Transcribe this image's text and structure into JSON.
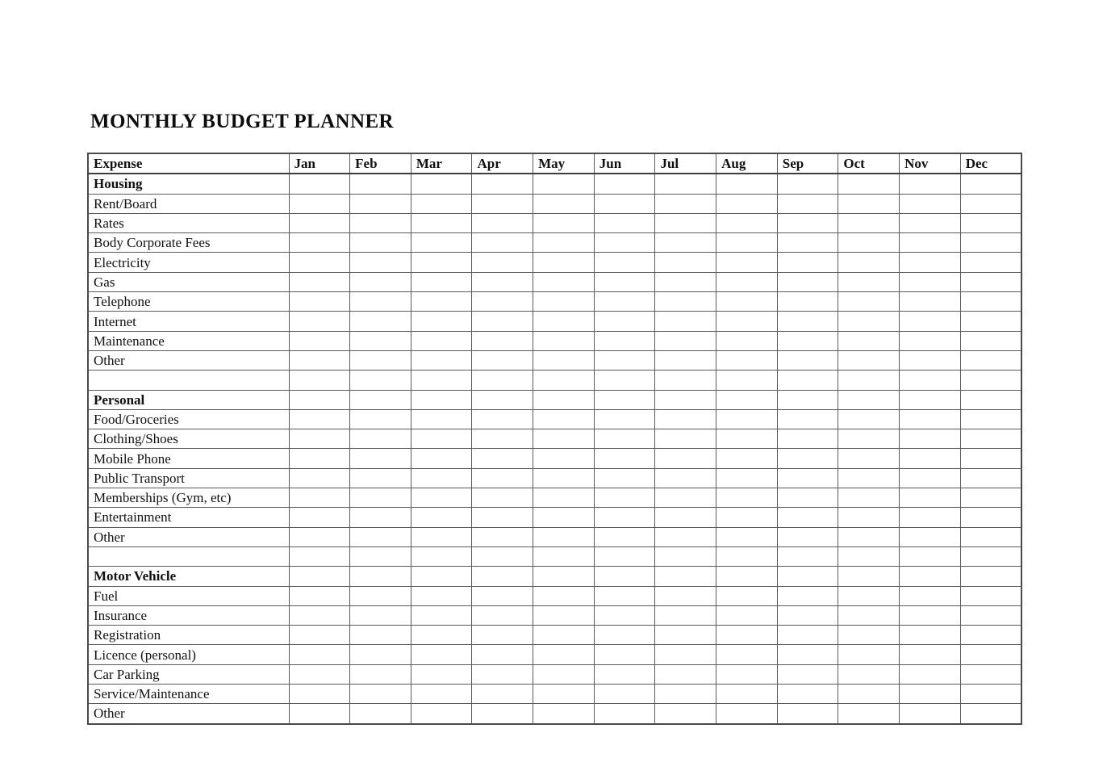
{
  "document": {
    "title": "MONTHLY BUDGET PLANNER"
  },
  "table": {
    "columns": [
      {
        "key": "expense",
        "label": "Expense"
      },
      {
        "key": "jan",
        "label": "Jan"
      },
      {
        "key": "feb",
        "label": "Feb"
      },
      {
        "key": "mar",
        "label": "Mar"
      },
      {
        "key": "apr",
        "label": "Apr"
      },
      {
        "key": "may",
        "label": "May"
      },
      {
        "key": "jun",
        "label": "Jun"
      },
      {
        "key": "jul",
        "label": "Jul"
      },
      {
        "key": "aug",
        "label": "Aug"
      },
      {
        "key": "sep",
        "label": "Sep"
      },
      {
        "key": "oct",
        "label": "Oct"
      },
      {
        "key": "nov",
        "label": "Nov"
      },
      {
        "key": "dec",
        "label": "Dec"
      }
    ],
    "rows": [
      {
        "type": "section",
        "label": "Housing",
        "values": [
          "",
          "",
          "",
          "",
          "",
          "",
          "",
          "",
          "",
          "",
          "",
          ""
        ]
      },
      {
        "type": "item",
        "label": "Rent/Board",
        "values": [
          "",
          "",
          "",
          "",
          "",
          "",
          "",
          "",
          "",
          "",
          "",
          ""
        ]
      },
      {
        "type": "item",
        "label": "Rates",
        "values": [
          "",
          "",
          "",
          "",
          "",
          "",
          "",
          "",
          "",
          "",
          "",
          ""
        ]
      },
      {
        "type": "item",
        "label": "Body Corporate Fees",
        "values": [
          "",
          "",
          "",
          "",
          "",
          "",
          "",
          "",
          "",
          "",
          "",
          ""
        ]
      },
      {
        "type": "item",
        "label": "Electricity",
        "values": [
          "",
          "",
          "",
          "",
          "",
          "",
          "",
          "",
          "",
          "",
          "",
          ""
        ]
      },
      {
        "type": "item",
        "label": "Gas",
        "values": [
          "",
          "",
          "",
          "",
          "",
          "",
          "",
          "",
          "",
          "",
          "",
          ""
        ]
      },
      {
        "type": "item",
        "label": "Telephone",
        "values": [
          "",
          "",
          "",
          "",
          "",
          "",
          "",
          "",
          "",
          "",
          "",
          ""
        ]
      },
      {
        "type": "item",
        "label": "Internet",
        "values": [
          "",
          "",
          "",
          "",
          "",
          "",
          "",
          "",
          "",
          "",
          "",
          ""
        ]
      },
      {
        "type": "item",
        "label": "Maintenance",
        "values": [
          "",
          "",
          "",
          "",
          "",
          "",
          "",
          "",
          "",
          "",
          "",
          ""
        ]
      },
      {
        "type": "item",
        "label": "Other",
        "values": [
          "",
          "",
          "",
          "",
          "",
          "",
          "",
          "",
          "",
          "",
          "",
          ""
        ]
      },
      {
        "type": "blank",
        "label": "",
        "values": [
          "",
          "",
          "",
          "",
          "",
          "",
          "",
          "",
          "",
          "",
          "",
          ""
        ]
      },
      {
        "type": "section",
        "label": "Personal",
        "values": [
          "",
          "",
          "",
          "",
          "",
          "",
          "",
          "",
          "",
          "",
          "",
          ""
        ]
      },
      {
        "type": "item",
        "label": "Food/Groceries",
        "values": [
          "",
          "",
          "",
          "",
          "",
          "",
          "",
          "",
          "",
          "",
          "",
          ""
        ]
      },
      {
        "type": "item",
        "label": "Clothing/Shoes",
        "values": [
          "",
          "",
          "",
          "",
          "",
          "",
          "",
          "",
          "",
          "",
          "",
          ""
        ]
      },
      {
        "type": "item",
        "label": "Mobile Phone",
        "values": [
          "",
          "",
          "",
          "",
          "",
          "",
          "",
          "",
          "",
          "",
          "",
          ""
        ]
      },
      {
        "type": "item",
        "label": "Public Transport",
        "values": [
          "",
          "",
          "",
          "",
          "",
          "",
          "",
          "",
          "",
          "",
          "",
          ""
        ]
      },
      {
        "type": "item",
        "label": "Memberships (Gym, etc)",
        "values": [
          "",
          "",
          "",
          "",
          "",
          "",
          "",
          "",
          "",
          "",
          "",
          ""
        ]
      },
      {
        "type": "item",
        "label": "Entertainment",
        "values": [
          "",
          "",
          "",
          "",
          "",
          "",
          "",
          "",
          "",
          "",
          "",
          ""
        ]
      },
      {
        "type": "item",
        "label": "Other",
        "values": [
          "",
          "",
          "",
          "",
          "",
          "",
          "",
          "",
          "",
          "",
          "",
          ""
        ]
      },
      {
        "type": "blank",
        "label": "",
        "values": [
          "",
          "",
          "",
          "",
          "",
          "",
          "",
          "",
          "",
          "",
          "",
          ""
        ]
      },
      {
        "type": "section",
        "label": "Motor Vehicle",
        "values": [
          "",
          "",
          "",
          "",
          "",
          "",
          "",
          "",
          "",
          "",
          "",
          ""
        ]
      },
      {
        "type": "item",
        "label": "Fuel",
        "values": [
          "",
          "",
          "",
          "",
          "",
          "",
          "",
          "",
          "",
          "",
          "",
          ""
        ]
      },
      {
        "type": "item",
        "label": "Insurance",
        "values": [
          "",
          "",
          "",
          "",
          "",
          "",
          "",
          "",
          "",
          "",
          "",
          ""
        ]
      },
      {
        "type": "item",
        "label": "Registration",
        "values": [
          "",
          "",
          "",
          "",
          "",
          "",
          "",
          "",
          "",
          "",
          "",
          ""
        ]
      },
      {
        "type": "item",
        "label": "Licence (personal)",
        "values": [
          "",
          "",
          "",
          "",
          "",
          "",
          "",
          "",
          "",
          "",
          "",
          ""
        ]
      },
      {
        "type": "item",
        "label": "Car Parking",
        "values": [
          "",
          "",
          "",
          "",
          "",
          "",
          "",
          "",
          "",
          "",
          "",
          ""
        ]
      },
      {
        "type": "item",
        "label": "Service/Maintenance",
        "values": [
          "",
          "",
          "",
          "",
          "",
          "",
          "",
          "",
          "",
          "",
          "",
          ""
        ]
      },
      {
        "type": "item",
        "label": "Other",
        "values": [
          "",
          "",
          "",
          "",
          "",
          "",
          "",
          "",
          "",
          "",
          "",
          ""
        ]
      }
    ]
  }
}
